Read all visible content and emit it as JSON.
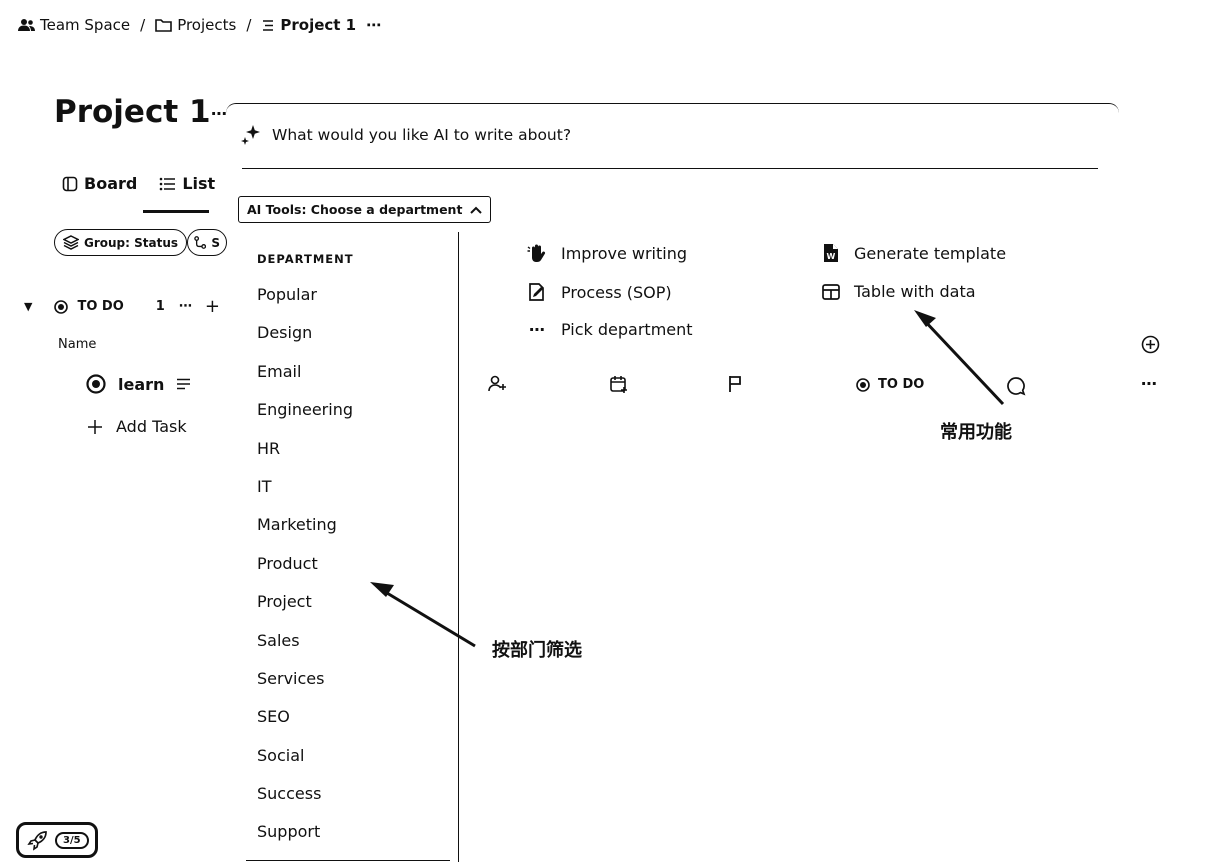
{
  "breadcrumb": {
    "team": "Team Space",
    "sep1": "/",
    "projects": "Projects",
    "sep2": "/",
    "current": "Project 1",
    "more": "⋯"
  },
  "page": {
    "title": "Project 1",
    "title_menu": "⋯"
  },
  "views": {
    "board": "Board",
    "list": "List"
  },
  "filters": {
    "group": "Group: Status",
    "subtasks": "S"
  },
  "group": {
    "status": "TO DO",
    "count": "1",
    "dots": "⋯",
    "plus": "+"
  },
  "columns": {
    "name": "Name"
  },
  "task": {
    "name": "learn",
    "status": "TO DO",
    "more": "⋯"
  },
  "add_task": "Add Task",
  "ai": {
    "prompt": "What would you like AI to write about?",
    "select_label": "AI Tools: Choose a department",
    "department_header": "DEPARTMENT",
    "departments": [
      "Popular",
      "Design",
      "Email",
      "Engineering",
      "HR",
      "IT",
      "Marketing",
      "Product",
      "Project",
      "Sales",
      "Services",
      "SEO",
      "Social",
      "Success",
      "Support"
    ],
    "tools": {
      "improve_writing": "Improve writing",
      "process_sop": "Process (SOP)",
      "pick_department": "Pick department",
      "generate_template": "Generate template",
      "table_with_data": "Table with data",
      "pick_icon": "⋯"
    }
  },
  "annotations": {
    "common_features": "常用功能",
    "filter_by_department": "按部门筛选"
  },
  "progress_badge": "3/5"
}
